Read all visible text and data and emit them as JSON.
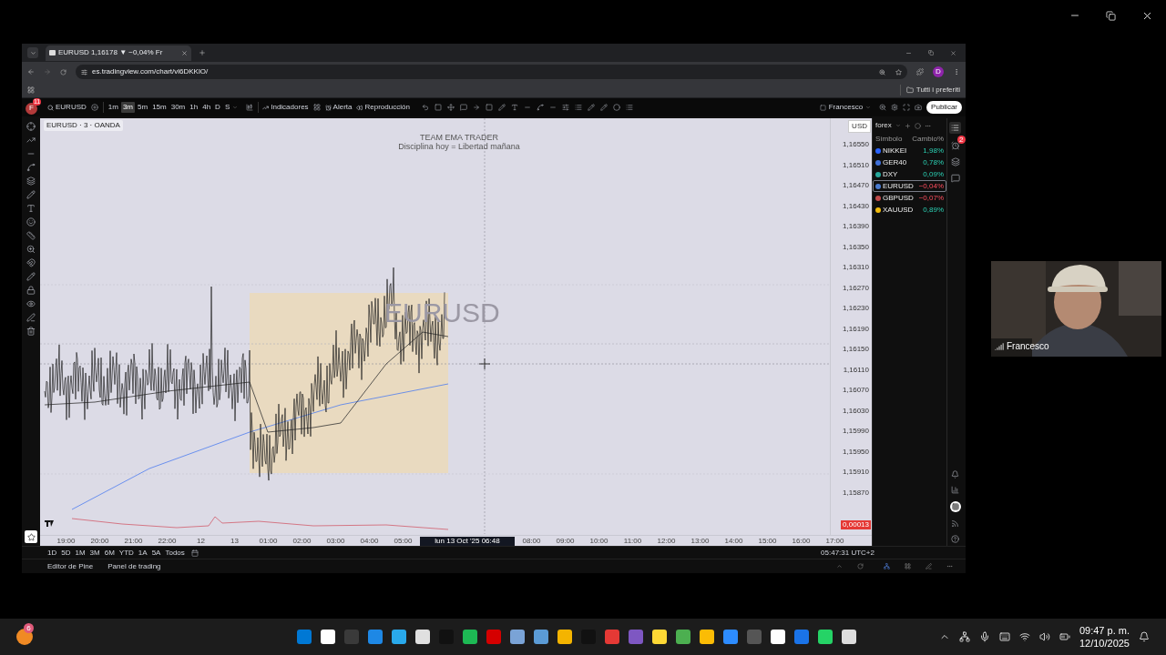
{
  "browser": {
    "tab_title": "EURUSD 1,16178 ▼ −0,04% Fr",
    "url": "es.tradingview.com/chart/vl6DKKlO/",
    "profile_initial": "D",
    "bookmarks_folder": "Tutti i preferiti"
  },
  "toolbar": {
    "avatar_initial": "F",
    "avatar_badge": "11",
    "symbol": "EURUSD",
    "timeframes": [
      {
        "label": "1m",
        "selected": false
      },
      {
        "label": "3m",
        "selected": true
      },
      {
        "label": "5m",
        "selected": false
      },
      {
        "label": "15m",
        "selected": false
      },
      {
        "label": "30m",
        "selected": false
      },
      {
        "label": "1h",
        "selected": false
      },
      {
        "label": "4h",
        "selected": false
      },
      {
        "label": "D",
        "selected": false
      },
      {
        "label": "S",
        "selected": false
      }
    ],
    "indicators": "Indicadores",
    "alert": "Alerta",
    "replay": "Reproducción",
    "user": "Francesco",
    "publish": "Publicar",
    "alerts_badge": "2"
  },
  "chart": {
    "legend": "EURUSD · 3 · OANDA",
    "title": "TEAM EMA TRADER",
    "subtitle": "Disciplina hoy = Libertad mañana",
    "watermark": "EURUSD",
    "currency": "USD",
    "indicator_value": "0,00013",
    "price_ticks": [
      "1,16550",
      "1,16510",
      "1,16470",
      "1,16430",
      "1,16390",
      "1,16350",
      "1,16310",
      "1,16270",
      "1,16230",
      "1,16190",
      "1,16150",
      "1,16110",
      "1,16070",
      "1,16030",
      "1,15990",
      "1,15950",
      "1,15910",
      "1,15870"
    ],
    "time_ticks": [
      {
        "kind": "tick",
        "label": "19:00"
      },
      {
        "kind": "tick",
        "label": "20:00"
      },
      {
        "kind": "tick",
        "label": "21:00"
      },
      {
        "kind": "tick",
        "label": "22:00"
      },
      {
        "kind": "tick",
        "label": "12"
      },
      {
        "kind": "tick",
        "label": "13"
      },
      {
        "kind": "tick",
        "label": "01:00"
      },
      {
        "kind": "tick",
        "label": "02:00"
      },
      {
        "kind": "tick",
        "label": "03:00"
      },
      {
        "kind": "tick",
        "label": "04:00"
      },
      {
        "kind": "tick",
        "label": "05:00"
      },
      {
        "kind": "crosshair",
        "label": "lun 13 Oct '25   06:48"
      },
      {
        "kind": "tick",
        "label": "08:00"
      },
      {
        "kind": "tick",
        "label": "09:00"
      },
      {
        "kind": "tick",
        "label": "10:00"
      },
      {
        "kind": "tick",
        "label": "11:00"
      },
      {
        "kind": "tick",
        "label": "12:00"
      },
      {
        "kind": "tick",
        "label": "13:00"
      },
      {
        "kind": "tick",
        "label": "14:00"
      },
      {
        "kind": "tick",
        "label": "15:00"
      },
      {
        "kind": "tick",
        "label": "16:00"
      },
      {
        "kind": "tick",
        "label": "17:00"
      }
    ]
  },
  "ranges": [
    "1D",
    "5D",
    "1M",
    "3M",
    "6M",
    "YTD",
    "1A",
    "5A",
    "Todos"
  ],
  "clock": "05:47:31 UTC+2",
  "panels": [
    "Editor de Pine",
    "Panel de trading"
  ],
  "watchlist": {
    "name": "forex",
    "columns": [
      "Símbolo",
      "Cambio%"
    ],
    "rows": [
      {
        "symbol": "NIKKEI",
        "change": "1,98%",
        "kind": "up",
        "selected": false,
        "color": "#2962ff"
      },
      {
        "symbol": "GER40",
        "change": "0,78%",
        "kind": "up",
        "selected": false,
        "color": "#3f6fd8"
      },
      {
        "symbol": "DXY",
        "change": "0,09%",
        "kind": "up",
        "selected": false,
        "color": "#26a69a"
      },
      {
        "symbol": "EURUSD",
        "change": "−0,04%",
        "kind": "down",
        "selected": true,
        "color": "#4a7bd0"
      },
      {
        "symbol": "GBPUSD",
        "change": "−0,07%",
        "kind": "down",
        "selected": false,
        "color": "#c04a4a"
      },
      {
        "symbol": "XAUUSD",
        "change": "0,89%",
        "kind": "up",
        "selected": false,
        "color": "#f0b90b"
      }
    ]
  },
  "webcam": {
    "name": "Francesco"
  },
  "taskbar": {
    "badge": "6",
    "time": "09:47 p. m.",
    "date": "12/10/2025"
  }
}
